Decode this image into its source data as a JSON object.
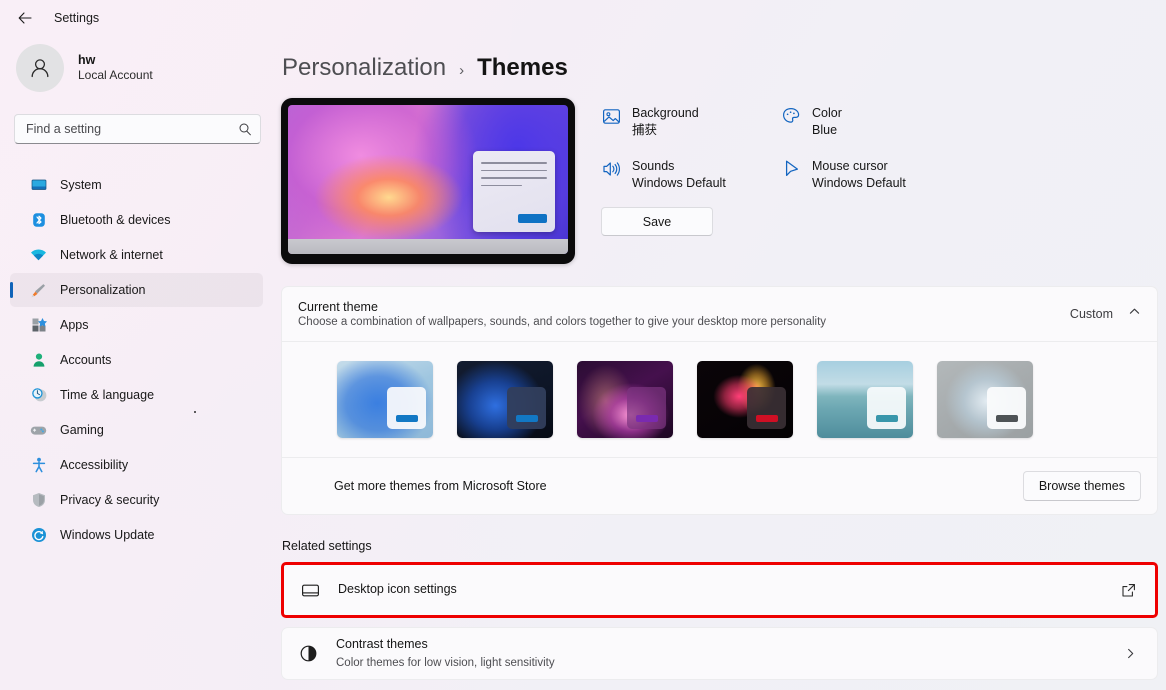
{
  "titlebar": {
    "back_label": "back-arrow",
    "title": "Settings"
  },
  "account": {
    "name": "hw",
    "type": "Local Account"
  },
  "search": {
    "placeholder": "Find a setting",
    "value": ""
  },
  "sidebar": {
    "items": [
      {
        "label": "System",
        "icon": "monitor-icon",
        "selected": false
      },
      {
        "label": "Bluetooth & devices",
        "icon": "bluetooth-icon",
        "selected": false
      },
      {
        "label": "Network & internet",
        "icon": "wifi-icon",
        "selected": false
      },
      {
        "label": "Personalization",
        "icon": "paintbrush-icon",
        "selected": true
      },
      {
        "label": "Apps",
        "icon": "apps-icon",
        "selected": false
      },
      {
        "label": "Accounts",
        "icon": "person-icon",
        "selected": false
      },
      {
        "label": "Time & language",
        "icon": "clock-icon",
        "selected": false
      },
      {
        "label": "Gaming",
        "icon": "gamepad-icon",
        "selected": false
      },
      {
        "label": "Accessibility",
        "icon": "accessibility-icon",
        "selected": false
      },
      {
        "label": "Privacy & security",
        "icon": "shield-icon",
        "selected": false
      },
      {
        "label": "Windows Update",
        "icon": "update-icon",
        "selected": false
      }
    ]
  },
  "breadcrumb": {
    "parent": "Personalization",
    "separator": "›",
    "current": "Themes"
  },
  "theme_options": [
    {
      "title": "Background",
      "value": "捕获",
      "icon": "image-icon"
    },
    {
      "title": "Color",
      "value": "Blue",
      "icon": "palette-icon"
    },
    {
      "title": "Sounds",
      "value": "Windows Default",
      "icon": "speaker-icon"
    },
    {
      "title": "Mouse cursor",
      "value": "Windows Default",
      "icon": "cursor-icon"
    }
  ],
  "save_button": "Save",
  "current_theme": {
    "title": "Current theme",
    "description": "Choose a combination of wallpapers, sounds, and colors together to give your desktop more personality",
    "value": "Custom",
    "chevron": "chevron-up-icon",
    "thumbnails": [
      {
        "name": "windows-light-theme",
        "class": "t1"
      },
      {
        "name": "windows-dark-theme",
        "class": "t2"
      },
      {
        "name": "glow-theme",
        "class": "t3"
      },
      {
        "name": "flow-theme",
        "class": "t4"
      },
      {
        "name": "sunrise-theme",
        "class": "t5"
      },
      {
        "name": "captured-motion-theme",
        "class": "t6"
      }
    ]
  },
  "store_row": {
    "label": "Get more themes from Microsoft Store",
    "button": "Browse themes"
  },
  "related": {
    "section_label": "Related settings",
    "rows": [
      {
        "title": "Desktop icon settings",
        "description": "",
        "icon": "desktop-icon",
        "action_icon": "external-link-icon",
        "highlighted": true
      },
      {
        "title": "Contrast themes",
        "description": "Color themes for low vision, light sensitivity",
        "icon": "contrast-icon",
        "action_icon": "chevron-right-icon",
        "highlighted": false
      }
    ]
  },
  "colors": {
    "accent": "#0f63b8",
    "highlight": "#ee0000",
    "card_bg": "#fbfafc"
  }
}
